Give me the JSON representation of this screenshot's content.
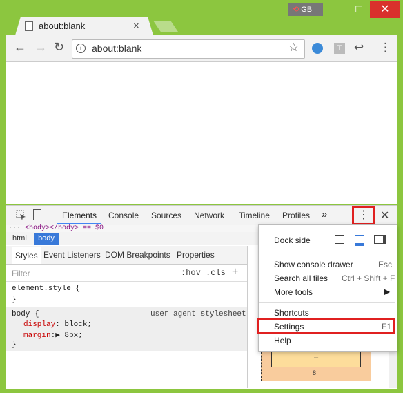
{
  "window": {
    "tab_title": "about:blank",
    "tab_close": "×",
    "profile_badge": "GB",
    "minimize": "–",
    "maximize": "☐",
    "close": "✕"
  },
  "omnibox": {
    "back": "←",
    "forward": "→",
    "reload": "↻",
    "info": "i",
    "url": "about:blank",
    "star": "☆",
    "ext_t": "T",
    "ext_arrow": "↩",
    "menu": "⋮"
  },
  "devtools": {
    "tabs": [
      "Elements",
      "Console",
      "Sources",
      "Network",
      "Timeline",
      "Profiles"
    ],
    "more_tabs": "»",
    "more_menu": "⋮",
    "close": "✕",
    "crumb": "<body></body> == $0",
    "path": [
      "html",
      "body"
    ],
    "subtabs": [
      "Styles",
      "Event Listeners",
      "DOM Breakpoints",
      "Properties"
    ],
    "filter_placeholder": "Filter",
    "hov": ":hov",
    "cls": ".cls",
    "plus": "+",
    "rules": {
      "element_style_open": "element.style {",
      "element_style_close": "}",
      "body_open": "body {",
      "ua_label": "user agent stylesheet",
      "prop1_name": "display",
      "prop1_value": ": block;",
      "prop2_name": "margin",
      "prop2_value": ":▶ 8px;",
      "body_close": "}"
    },
    "box_model": {
      "inner": "–",
      "margin_bottom": "8"
    }
  },
  "menu": {
    "dock_side": "Dock side",
    "items": [
      {
        "label": "Show console drawer",
        "key": "Esc"
      },
      {
        "label": "Search all files",
        "key": "Ctrl + Shift + F"
      },
      {
        "label": "More tools",
        "key": "▶"
      },
      {
        "label": "Shortcuts",
        "key": ""
      },
      {
        "label": "Settings",
        "key": "F1"
      },
      {
        "label": "Help",
        "key": ""
      }
    ]
  },
  "colors": {
    "frame": "#8cc63f",
    "highlight": "#e02020",
    "selected": "#3879d9"
  }
}
